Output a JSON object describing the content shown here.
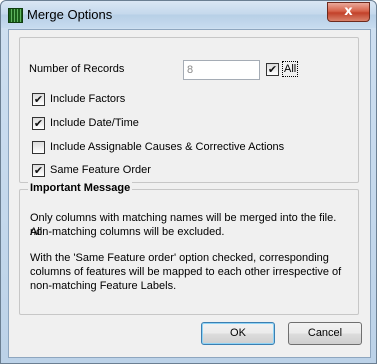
{
  "window": {
    "title": "Merge Options",
    "close_label": "x"
  },
  "options": {
    "records_label": "Number of Records",
    "records_value": "8",
    "all_label": "All",
    "all_checked": true,
    "include_factors_label": "Include Factors",
    "include_factors_checked": true,
    "include_datetime_label": "Include Date/Time",
    "include_datetime_checked": true,
    "include_causes_label": "Include Assignable Causes & Corrective Actions",
    "include_causes_checked": false,
    "same_feature_order_label": "Same Feature Order",
    "same_feature_order_checked": true
  },
  "message": {
    "title": "Important Message",
    "line1a": "Only columns with matching names will be merged into the file. All",
    "line1b": "non-matching columns will be excluded.",
    "line2a": "With the 'Same Feature order' option checked, corresponding",
    "line2b": "columns of features will be mapped to each other irrespective of",
    "line2c": "non-matching Feature Labels."
  },
  "buttons": {
    "ok_label": "OK",
    "cancel_label": "Cancel"
  },
  "check_glyph": "✔"
}
